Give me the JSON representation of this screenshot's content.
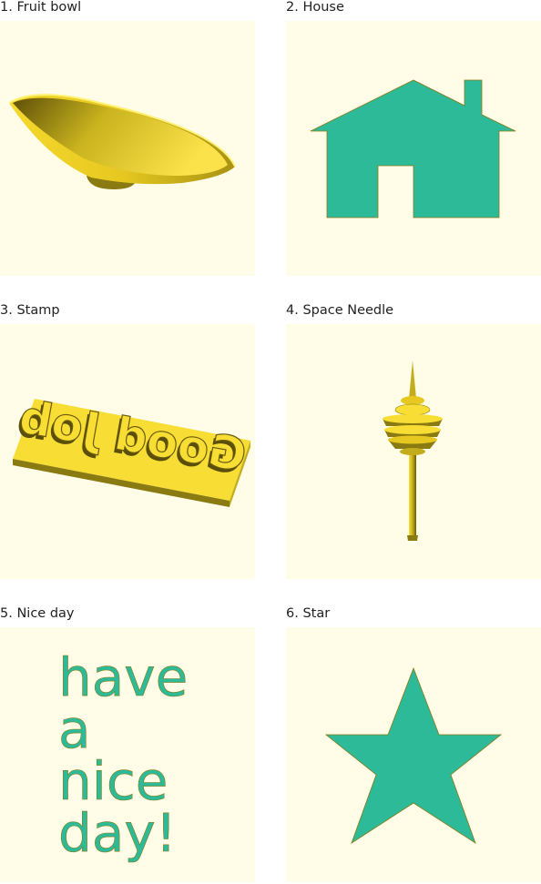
{
  "colors": {
    "panel_bg": "#fffce8",
    "yellow": "#f7dd34",
    "yellow_dark": "#8a7a12",
    "teal": "#2dba98"
  },
  "items": [
    {
      "label": "1. Fruit bowl",
      "icon": "fruit-bowl-icon"
    },
    {
      "label": "2. House",
      "icon": "house-icon"
    },
    {
      "label": "3. Stamp",
      "icon": "stamp-icon",
      "stamp_text": "Good Job"
    },
    {
      "label": "4. Space Needle",
      "icon": "space-needle-icon"
    },
    {
      "label": "5. Nice day",
      "icon": "nice-day-text",
      "text_lines": [
        "have",
        "a",
        "nice",
        "day!"
      ]
    },
    {
      "label": "6. Star",
      "icon": "star-icon"
    }
  ]
}
